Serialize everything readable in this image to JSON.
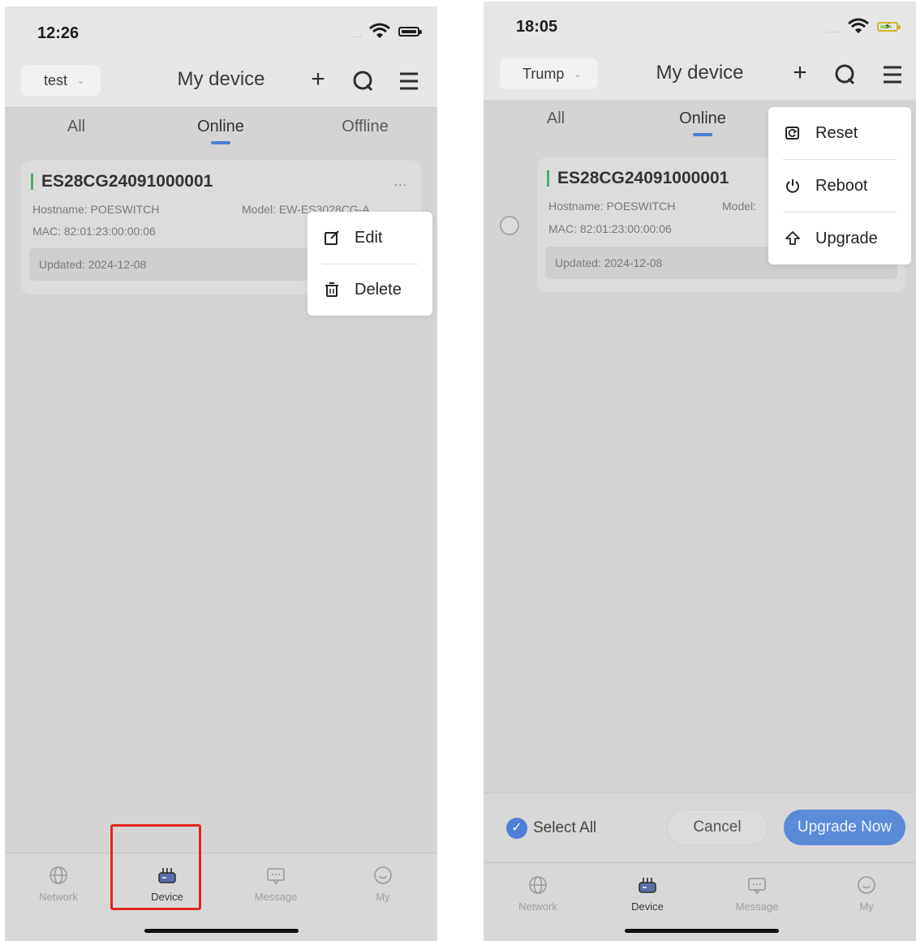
{
  "screen1": {
    "status": {
      "time": "12:26",
      "signal": "....."
    },
    "header": {
      "group": "test",
      "title": "My device"
    },
    "tabs": [
      "All",
      "Online",
      "Offline"
    ],
    "device": {
      "name": "ES28CG24091000001",
      "more": "...",
      "hostname": "Hostname: POESWITCH",
      "model": "Model: EW-ES3028CG-A",
      "mac": "MAC: 82:01:23:00:00:06",
      "updated": "Updated: 2024-12-08"
    },
    "menu": {
      "edit": "Edit",
      "delete": "Delete"
    },
    "tabbar": {
      "network": "Network",
      "device": "Device",
      "message": "Message",
      "my": "My"
    }
  },
  "screen2": {
    "status": {
      "time": "18:05",
      "signal": "....."
    },
    "header": {
      "group": "Trump",
      "title": "My device"
    },
    "tabs": [
      "All",
      "Online"
    ],
    "device": {
      "name": "ES28CG24091000001",
      "hostname": "Hostname: POESWITCH",
      "model": "Model:",
      "mac": "MAC: 82:01:23:00:00:06",
      "updated": "Updated: 2024-12-08"
    },
    "menu": {
      "reset": "Reset",
      "reboot": "Reboot",
      "upgrade": "Upgrade"
    },
    "actions": {
      "select_all": "Select All",
      "cancel": "Cancel",
      "upgrade_now": "Upgrade Now"
    },
    "tabbar": {
      "network": "Network",
      "device": "Device",
      "message": "Message",
      "my": "My"
    }
  },
  "colors": {
    "accent": "#4d7fd6",
    "online_bar": "#4caf6a",
    "highlight": "#e0261f"
  }
}
